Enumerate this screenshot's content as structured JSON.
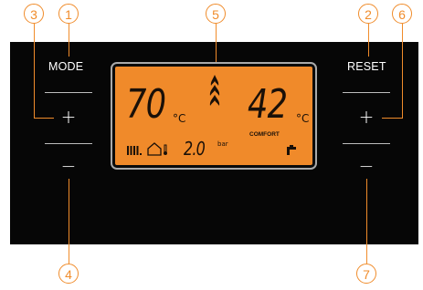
{
  "callouts": {
    "c1": "1",
    "c2": "2",
    "c3": "3",
    "c4": "4",
    "c5": "5",
    "c6": "6",
    "c7": "7"
  },
  "left": {
    "mode_label": "MODE",
    "plus": "+",
    "minus": "−"
  },
  "right": {
    "reset_label": "RESET",
    "plus": "+",
    "minus": "−"
  },
  "display": {
    "heating_temp": "70",
    "heating_unit": "°C",
    "dhw_temp": "42",
    "dhw_unit": "°C",
    "comfort_label": "COMFORT",
    "pressure": "2.0",
    "pressure_unit": "bar"
  },
  "icons": {
    "flame": "flame-icon",
    "radiator": "radiator-icon",
    "house": "house-thermometer-icon",
    "tap": "tap-icon"
  },
  "colors": {
    "accent": "#f08c2b",
    "lcd_background": "#f08a2a",
    "panel": "#060606",
    "segment": "#1a1008"
  }
}
